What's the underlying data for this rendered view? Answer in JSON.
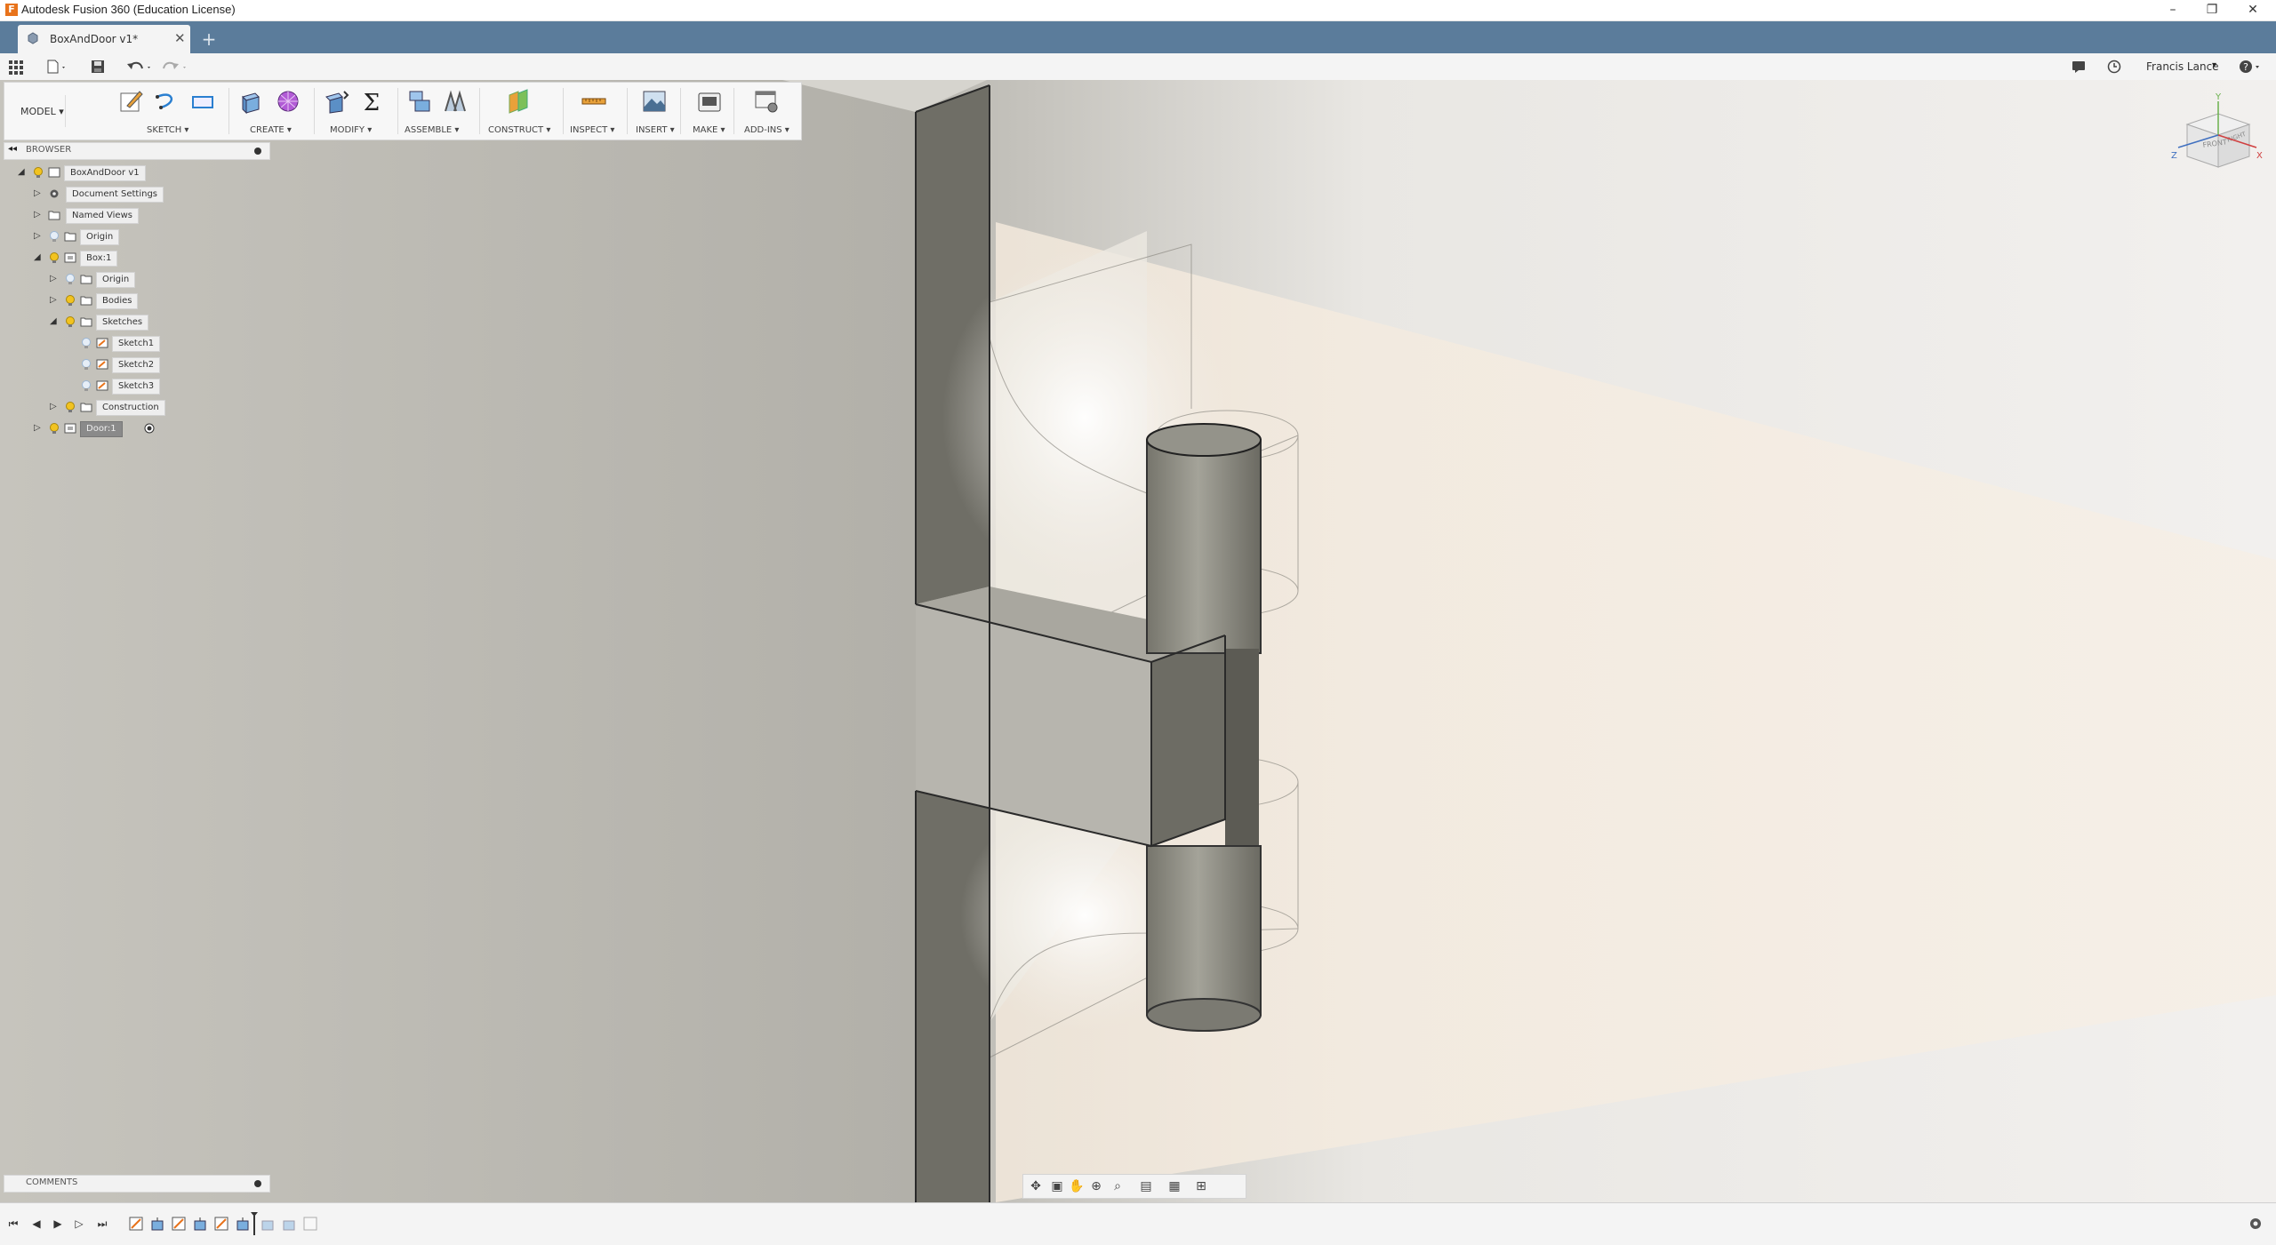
{
  "window": {
    "title": "Autodesk Fusion 360 (Education License)",
    "logo_letter": "F",
    "minimize": "–",
    "restore": "❐",
    "close": "✕"
  },
  "tabs": {
    "active_label": "BoxAndDoor v1*",
    "close": "✕",
    "new_tab": "+"
  },
  "quick_access": {
    "user_name": "Francis Lance",
    "user_caret": "▾"
  },
  "ribbon": {
    "workspace": "MODEL ▾",
    "groups": {
      "sketch": "SKETCH ▾",
      "create": "CREATE ▾",
      "modify": "MODIFY ▾",
      "assemble": "ASSEMBLE ▾",
      "construct": "CONSTRUCT ▾",
      "inspect": "INSPECT ▾",
      "insert": "INSERT ▾",
      "make": "MAKE ▾",
      "addins": "ADD-INS ▾"
    },
    "modify_symbol": "Σ"
  },
  "browser": {
    "title": "BROWSER",
    "nodes": [
      {
        "label": "BoxAndDoor v1"
      },
      {
        "label": "Document Settings"
      },
      {
        "label": "Named Views"
      },
      {
        "label": "Origin"
      },
      {
        "label": "Box:1"
      },
      {
        "label": "Origin"
      },
      {
        "label": "Bodies"
      },
      {
        "label": "Sketches"
      },
      {
        "label": "Sketch1"
      },
      {
        "label": "Sketch2"
      },
      {
        "label": "Sketch3"
      },
      {
        "label": "Construction"
      },
      {
        "label": "Door:1"
      }
    ]
  },
  "comments": {
    "title": "COMMENTS"
  },
  "viewcube": {
    "front": "FRONT",
    "right": "RIGHT",
    "x": "X",
    "y": "Y",
    "z": "Z"
  },
  "colors": {
    "accent_orange": "#e8731b",
    "tab_strip": "#5b7c9b",
    "bulb_on": "#f2c320",
    "bulb_off": "#9bb6d4"
  }
}
